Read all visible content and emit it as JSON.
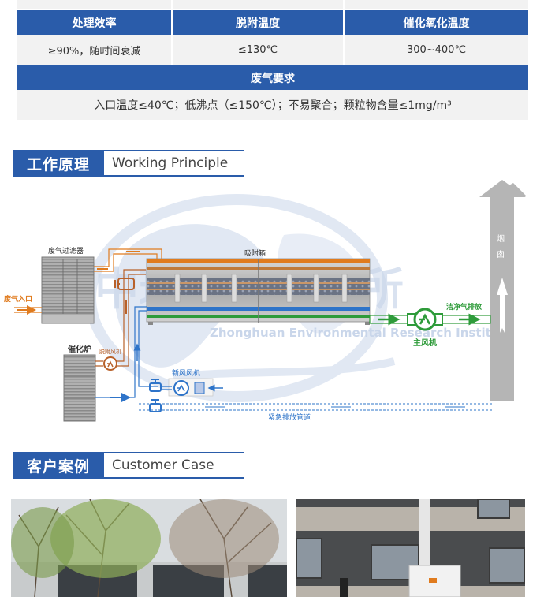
{
  "spec_table": {
    "top_row_partial": [
      "",
      "",
      ""
    ],
    "headers": [
      "处理效率",
      "脱附温度",
      "催化氧化温度"
    ],
    "values": [
      "≥90%，随时间衰减",
      "≤130℃",
      "300~400℃"
    ],
    "section_title": "废气要求",
    "requirements": "入口温度≤40℃；低沸点（≤150℃）；不易聚合；颗粒物含量≤1mg/m³"
  },
  "sections": {
    "principle": {
      "zh": "工作原理",
      "en": "Working Principle"
    },
    "case": {
      "zh": "客户案例",
      "en": "Customer  Case"
    }
  },
  "diagram": {
    "labels": {
      "filter": "废气过滤器",
      "inlet": "废气入口",
      "adsorber": "吸附箱",
      "catalytic_furnace": "催化炉",
      "desorption_fan": "脱附风机",
      "fresh_air_fan": "新风风机",
      "emergency_pipe": "紧急排放管道",
      "main_fan": "主风机",
      "clean_exhaust": "洁净气排放",
      "chimney_1": "烟",
      "chimney_2": "囱"
    },
    "watermark": {
      "zh": "中环环境研究所",
      "en": "Zhonghuan Environmental Research Institute"
    },
    "colors": {
      "orange": "#e07b1e",
      "brown": "#b8612a",
      "blue": "#2e74c9",
      "green": "#2e9b3a",
      "chimney": "#b5b5b5",
      "watermark": "#c9d6ea"
    }
  },
  "case_photos": [
    {
      "alt": "案例现场-树木与厂房"
    },
    {
      "alt": "案例现场-设备与楼房"
    }
  ],
  "colors": {
    "brand_blue": "#2a5caa",
    "table_bg": "#f2f2f2"
  }
}
